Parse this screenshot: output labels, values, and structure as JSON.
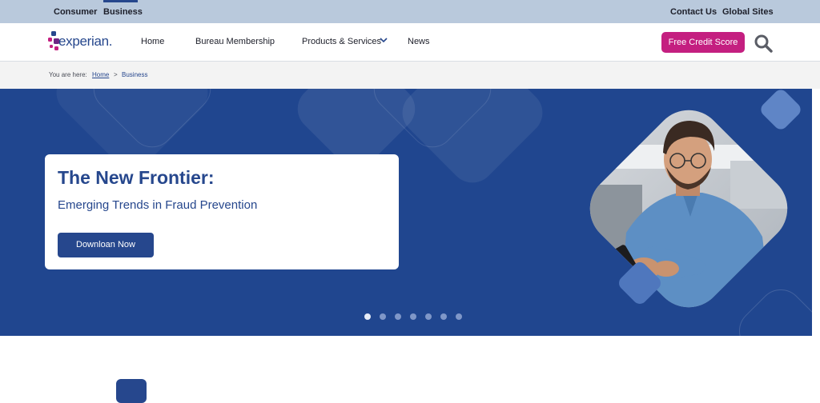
{
  "topbar": {
    "consumer": "Consumer",
    "business": "Business",
    "contact": "Contact Us",
    "global": "Global Sites"
  },
  "brand": {
    "logo_text": "experian.",
    "accent": "#26478d",
    "cta_color": "#c41f80"
  },
  "nav": {
    "home": "Home",
    "bureau": "Bureau Membership",
    "products": "Products & Services",
    "news": "News",
    "cta": "Free Credit Score",
    "search_icon": "search-icon",
    "dropdown_icon": "chevron-down-icon"
  },
  "breadcrumb": {
    "prefix": "You are here:",
    "home": "Home",
    "separator": ">",
    "current": "Business"
  },
  "hero": {
    "title": "The New Frontier:",
    "subtitle": "Emerging Trends in Fraud Prevention",
    "button": "Downloan Now",
    "slide_count": 7,
    "active_slide": 1
  }
}
